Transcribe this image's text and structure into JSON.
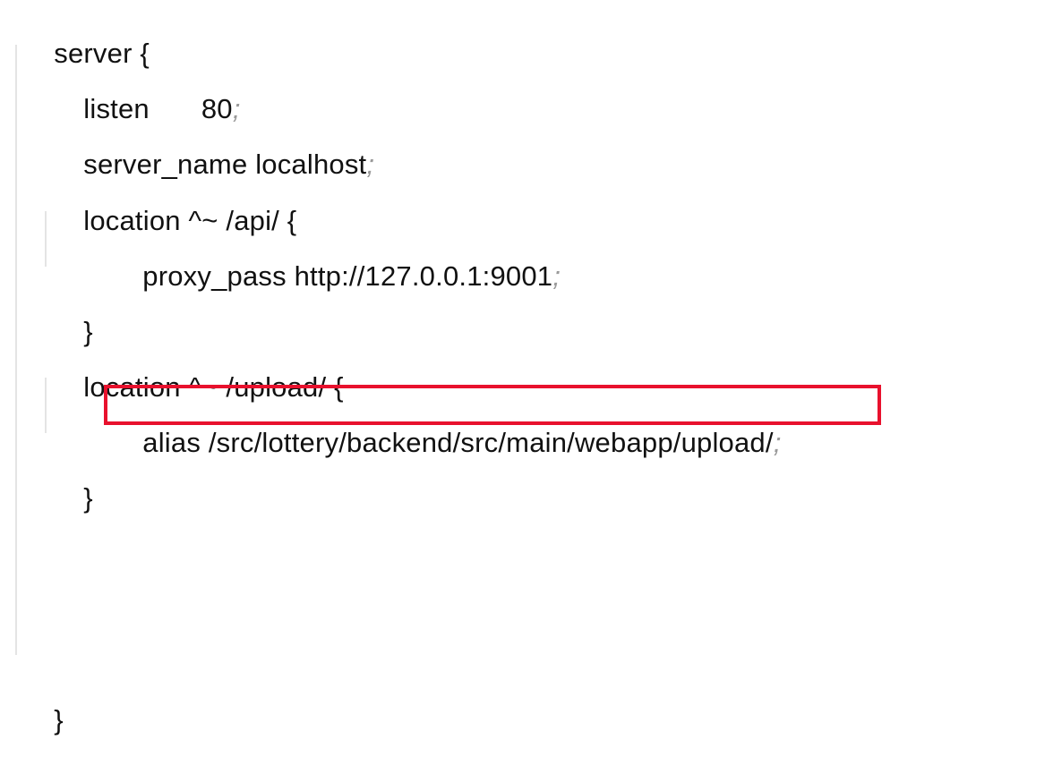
{
  "code": {
    "l1": "server {",
    "l2_key": "listen",
    "l2_val": "80",
    "l3": "server_name localhost",
    "l4": "location ^~ /api/ {",
    "l5": "proxy_pass http://127.0.0.1:9001",
    "l6": "}",
    "l7": "location ^~ /upload/ {",
    "l8": "alias /src/lottery/backend/src/main/webapp/upload/",
    "l9": "}",
    "l10": "}",
    "semicolon": ";"
  },
  "colors": {
    "text": "#111111",
    "semicolon": "#9a9a9a",
    "guide": "#e4e4e4",
    "highlight_border": "#e8112d"
  }
}
